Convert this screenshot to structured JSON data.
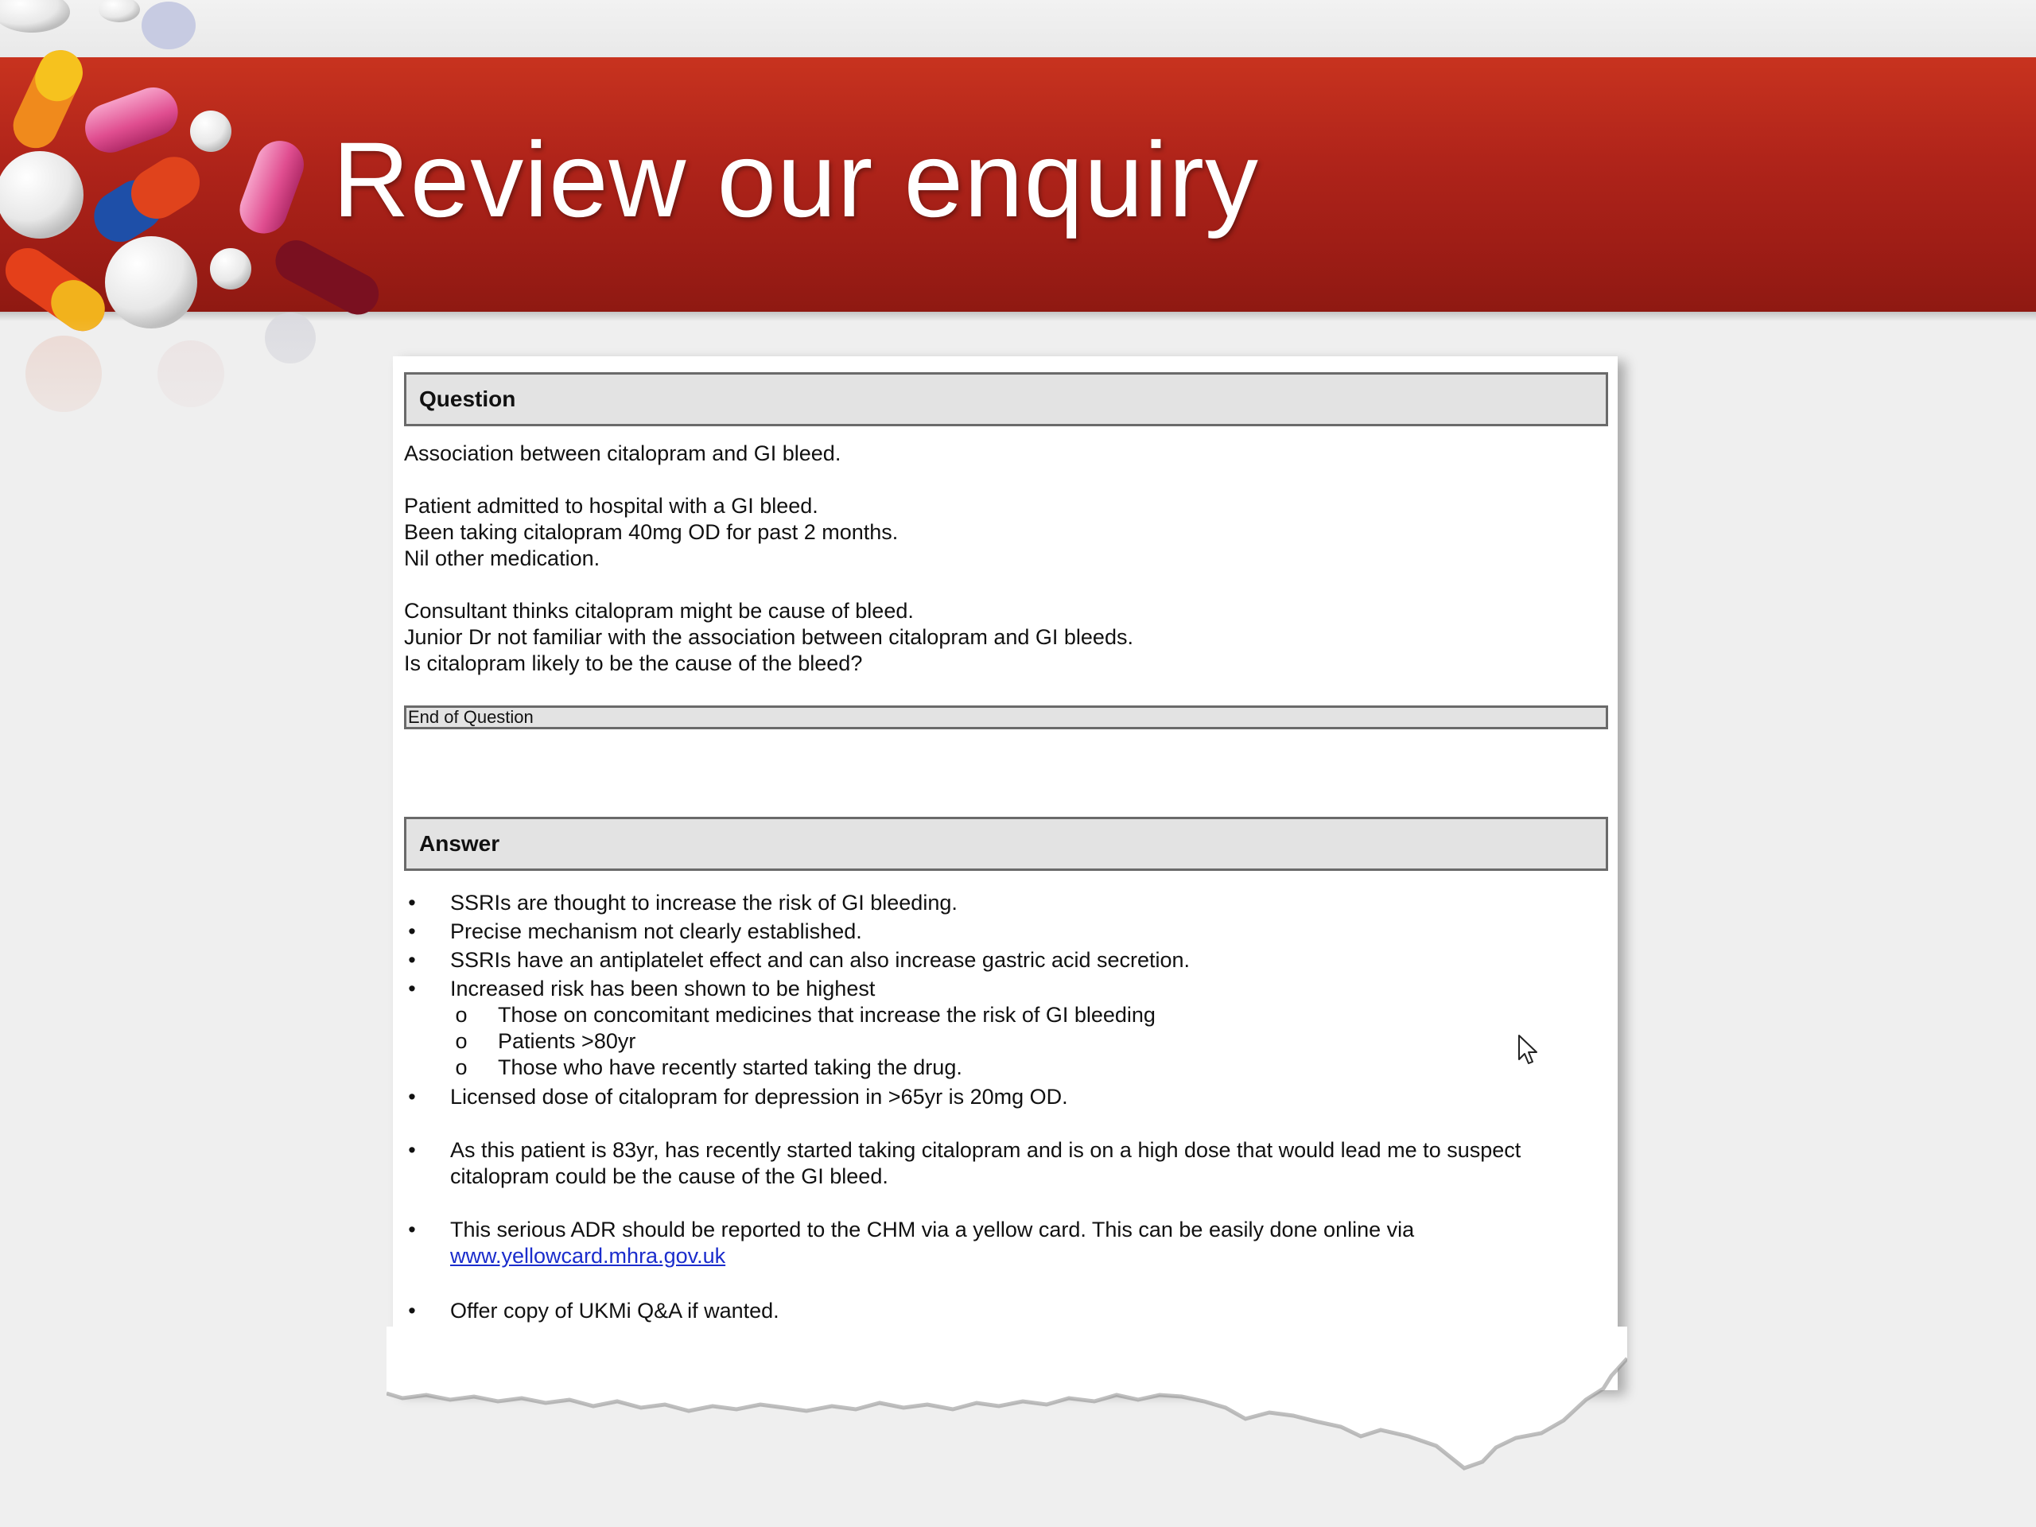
{
  "slide": {
    "title": "Review our enquiry"
  },
  "question": {
    "header": "Question",
    "lines": [
      "Association between citalopram and GI bleed.",
      "Patient admitted to hospital with a GI bleed.",
      "Been taking citalopram 40mg OD for past 2 months.",
      "Nil other medication.",
      "Consultant thinks citalopram might be cause of bleed.",
      "Junior Dr not familiar with the association between citalopram and GI bleeds.",
      "Is citalopram likely to be the cause of the bleed?"
    ],
    "end_label": "End of Question"
  },
  "answer": {
    "header": "Answer",
    "bullets": [
      "SSRIs are thought to increase the risk of GI bleeding.",
      "Precise mechanism not clearly established.",
      "SSRIs have an antiplatelet effect and can also increase gastric acid secretion.",
      "Increased risk has been shown to be highest",
      "Licensed dose of citalopram for depression in >65yr is 20mg OD.",
      "As this patient is 83yr, has recently started taking citalopram and is on a high dose that would lead me to suspect",
      "citalopram could be the cause of the GI bleed.",
      "This serious ADR should be reported to the CHM via a yellow card. This can be easily done online via",
      "Offer copy of UKMi Q&A if wanted."
    ],
    "sub_bullets": [
      "Those on concomitant medicines that increase the risk of GI bleeding",
      "Patients >80yr",
      "Those who have recently started taking the drug."
    ],
    "link_text": "www.yellowcard.mhra.gov.uk",
    "bullet_glyph": "•",
    "sub_bullet_glyph": "o"
  },
  "colors": {
    "banner": "#b0241a",
    "link": "#1a2ccc"
  }
}
